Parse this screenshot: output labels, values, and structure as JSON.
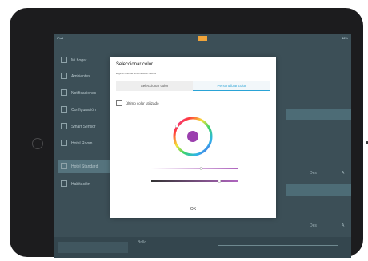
{
  "status": {
    "carrier": "iPad",
    "battery": "46%"
  },
  "sidebar": {
    "items": [
      {
        "label": "Mi hogar"
      },
      {
        "label": "Ambientes"
      },
      {
        "label": "Notificaciones"
      },
      {
        "label": "Configuración"
      },
      {
        "label": "Smart Sensor"
      },
      {
        "label": "Hotel Room"
      },
      {
        "label": "Hotel Standard"
      },
      {
        "label": "Habitación"
      }
    ]
  },
  "background": {
    "right_label_1": "Des",
    "right_value_1": "A",
    "right_label_2": "Des",
    "right_value_2": "A",
    "bottom_label": "Brillo"
  },
  "modal": {
    "title": "Seleccionar color",
    "subtitle": "Elige el color de la iluminación interior",
    "tabs": [
      {
        "label": "Seleccionar color"
      },
      {
        "label": "Personalizar color"
      }
    ],
    "last_color_label": "Último color utilizado",
    "ok_label": "OK",
    "selected_color": "#9b3fae",
    "hue_slider_value": 0.58,
    "brightness_slider_value": 0.79
  }
}
